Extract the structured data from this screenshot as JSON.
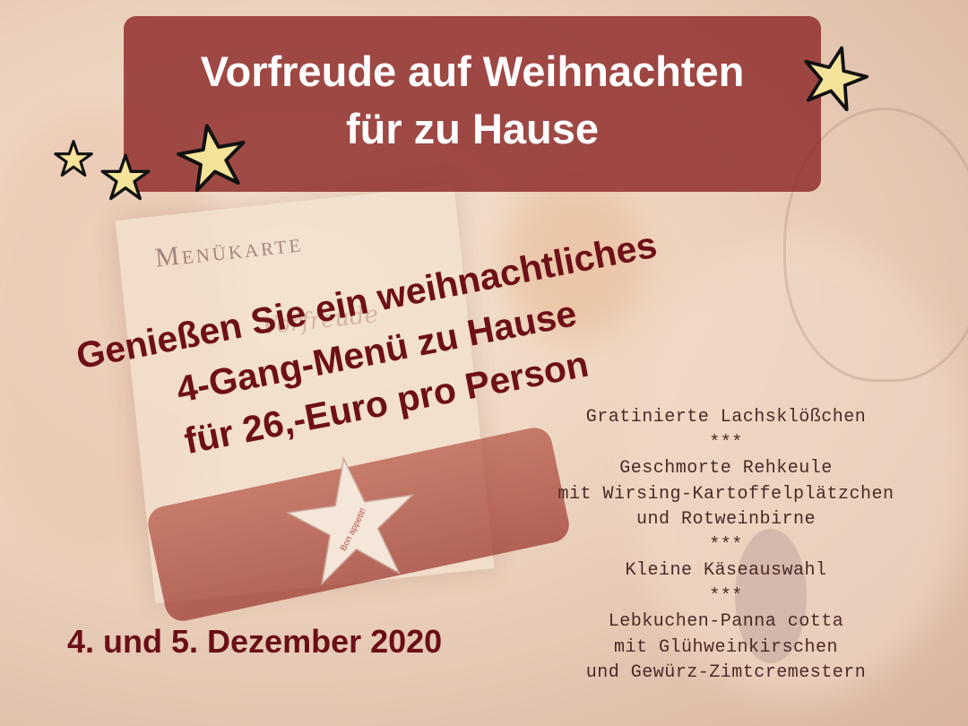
{
  "banner": {
    "line1": "Vorfreude auf Weihnachten",
    "line2": "für zu Hause"
  },
  "background_card": {
    "title": "Menükarte",
    "script": "Vorfreude"
  },
  "headline": {
    "line1": "Genießen Sie ein weihnachtliches",
    "line2": "4-Gang-Menü zu Hause",
    "line3": "für 26,-Euro pro Person"
  },
  "date": "4. und 5. Dezember 2020",
  "star_tag_text": "Bon appetit!",
  "menu": [
    "Gratinierte Lachsklößchen",
    "***",
    "Geschmorte Rehkeule",
    "mit Wirsing-Kartoffelplätzchen",
    "und Rotweinbirne",
    "***",
    "Kleine Käseauswahl",
    "***",
    "Lebkuchen-Panna cotta",
    "mit Glühweinkirschen",
    "und Gewürz-Zimtcremestern"
  ],
  "colors": {
    "banner": "#8c2828",
    "headline": "#6e1017",
    "star_fill": "#f6e39a",
    "star_outline": "#111111"
  }
}
